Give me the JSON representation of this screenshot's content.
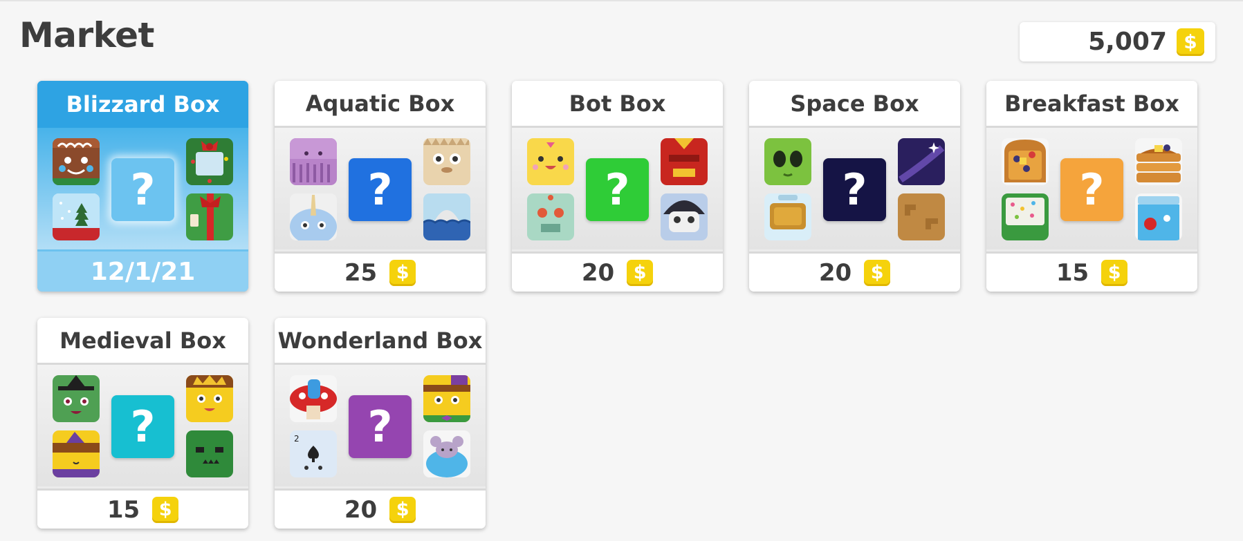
{
  "page": {
    "title": "Market"
  },
  "wallet": {
    "balance": "5,007",
    "currency_symbol": "$"
  },
  "boxes": [
    {
      "name": "Blizzard Box",
      "price": "",
      "date": "12/1/21",
      "featured": true,
      "mystery_color": "#6cc3f0",
      "mystery_symbol": "?",
      "blooks": [
        "gingerbread-blook",
        "wreath-blook",
        "snow-globe-blook",
        "present-blook"
      ]
    },
    {
      "name": "Aquatic Box",
      "price": "25",
      "mystery_color": "#2071e0",
      "mystery_symbol": "?",
      "blooks": [
        "jellyfish-blook",
        "pufferfish-blook",
        "narwhal-blook",
        "shark-blook"
      ]
    },
    {
      "name": "Bot Box",
      "price": "20",
      "mystery_color": "#2fcc37",
      "mystery_symbol": "?",
      "blooks": [
        "yellow-bot-blook",
        "red-bot-blook",
        "green-bot-blook",
        "helmet-bot-blook"
      ]
    },
    {
      "name": "Space Box",
      "price": "20",
      "mystery_color": "#151445",
      "mystery_symbol": "?",
      "blooks": [
        "alien-blook",
        "galaxy-blook",
        "astronaut-blook",
        "mars-blook"
      ]
    },
    {
      "name": "Breakfast Box",
      "price": "15",
      "mystery_color": "#f5a43c",
      "mystery_symbol": "?",
      "blooks": [
        "toast-blook",
        "pancakes-blook",
        "cereal-blook",
        "yogurt-blook"
      ]
    },
    {
      "name": "Medieval Box",
      "price": "15",
      "mystery_color": "#17bfd1",
      "mystery_symbol": "?",
      "blooks": [
        "witch-blook",
        "king-blook",
        "wizard-blook",
        "orc-blook"
      ]
    },
    {
      "name": "Wonderland Box",
      "price": "20",
      "mystery_color": "#9545b0",
      "mystery_symbol": "?",
      "blooks": [
        "caterpillar-blook",
        "mad-hatter-blook",
        "two-of-spades-blook",
        "dormouse-blook"
      ]
    }
  ]
}
